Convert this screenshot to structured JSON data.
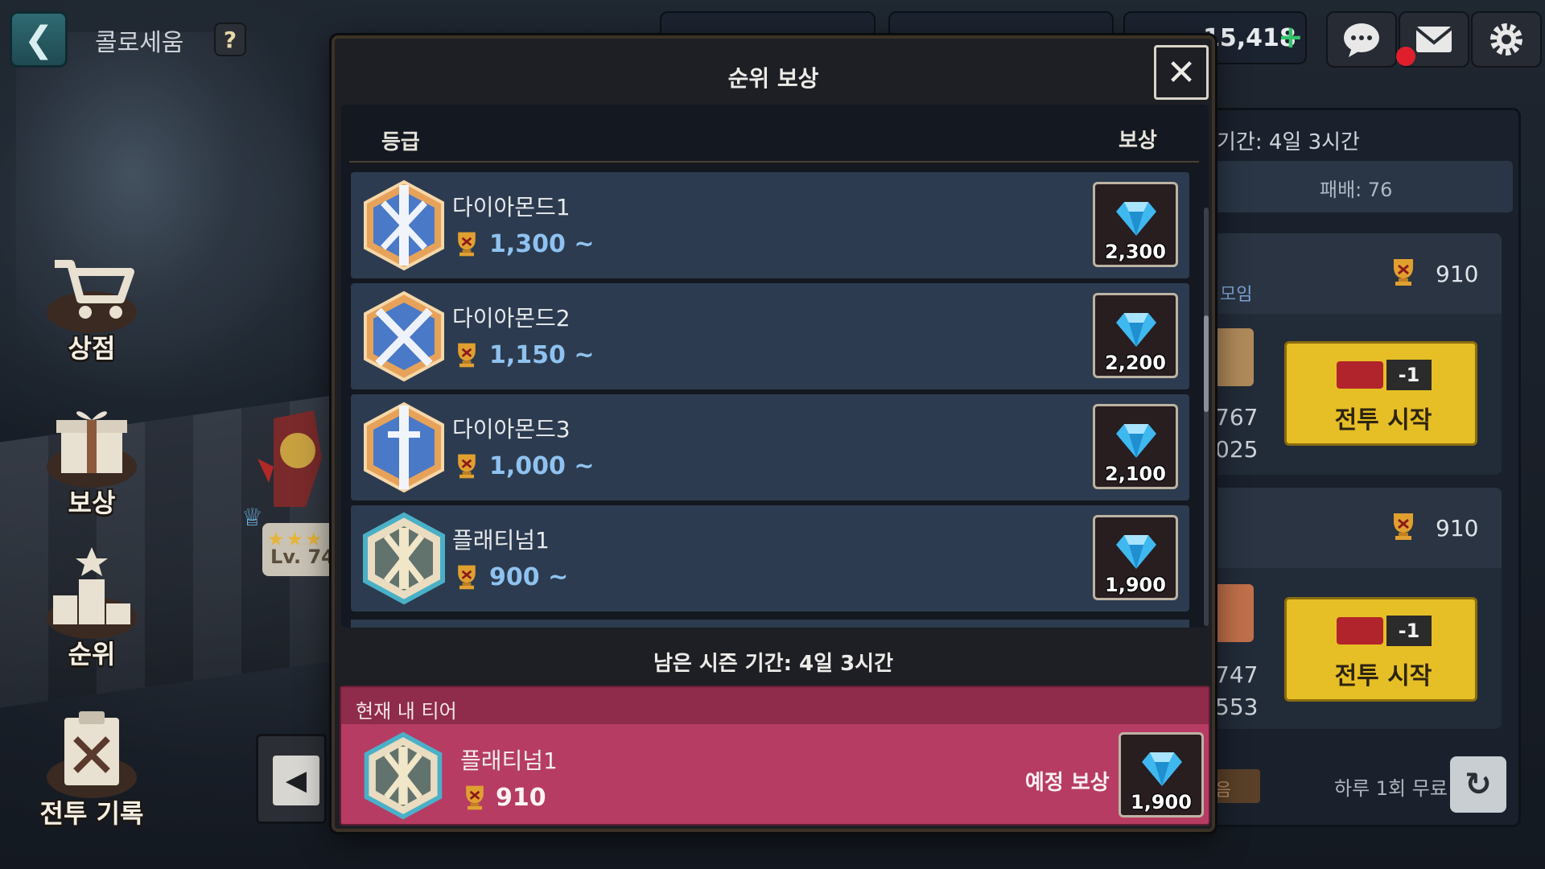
{
  "topbar": {
    "title": "콜로세움",
    "help": "?",
    "gem_count": "15,418",
    "plus": "+"
  },
  "side_menu": [
    {
      "label": "상점",
      "icon": "shop-cart-icon"
    },
    {
      "label": "보상",
      "icon": "gift-box-icon"
    },
    {
      "label": "순위",
      "icon": "podium-icon"
    },
    {
      "label": "전투 기록",
      "icon": "battle-log-icon"
    }
  ],
  "character": {
    "level": "Lv. 74",
    "stars": "★★★"
  },
  "right_panel": {
    "period": "기간: 4일 3시간",
    "losses": "패배: 76",
    "opponents": [
      {
        "trophies": "910",
        "group": "모임",
        "stat1": "767",
        "stat2": "025",
        "cost": "-1",
        "button": "전투 시작"
      },
      {
        "trophies": "910",
        "stat1": "747",
        "stat2": "553",
        "cost": "-1",
        "button": "전투 시작"
      }
    ],
    "free_label": "하루 1회 무료",
    "stub_text": "음"
  },
  "modal": {
    "title": "순위 보상",
    "col_grade": "등급",
    "col_reward": "보상",
    "rows": [
      {
        "name": "다이아몬드1",
        "points": "1,300 ~",
        "reward": "2,300",
        "emblem": "diamond-tier-1-emblem"
      },
      {
        "name": "다이아몬드2",
        "points": "1,150 ~",
        "reward": "2,200",
        "emblem": "diamond-tier-2-emblem"
      },
      {
        "name": "다이아몬드3",
        "points": "1,000 ~",
        "reward": "2,100",
        "emblem": "diamond-tier-3-emblem"
      },
      {
        "name": "플래티넘1",
        "points": "900 ~",
        "reward": "1,900",
        "emblem": "platinum-tier-1-emblem"
      }
    ],
    "season_left": "남은 시즌 기간: 4일 3시간",
    "my_tier": {
      "header": "현재 내 티어",
      "name": "플래티넘1",
      "points": "910",
      "expected_label": "예정 보상",
      "reward": "1,900"
    }
  },
  "colors": {
    "row_bg": "#2c3b4f",
    "points_blue": "#8fc2f0",
    "my_tier_bg": "#b63c63",
    "battle_btn": "#e6bf26",
    "gem": "#3fb8f0"
  }
}
